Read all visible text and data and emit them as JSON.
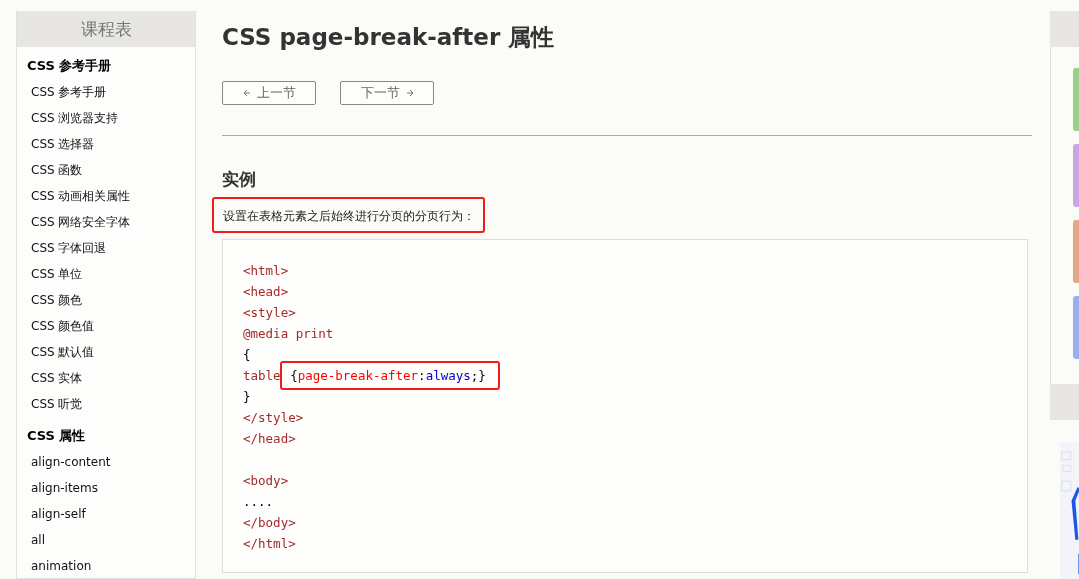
{
  "sidebar": {
    "title": "课程表",
    "sections": [
      {
        "heading": "CSS 参考手册",
        "items": [
          "CSS 参考手册",
          "CSS 浏览器支持",
          "CSS 选择器",
          "CSS 函数",
          "CSS 动画相关属性",
          "CSS 网络安全字体",
          "CSS 字体回退",
          "CSS 单位",
          "CSS 颜色",
          "CSS 颜色值",
          "CSS 默认值",
          "CSS 实体",
          "CSS 听觉"
        ]
      },
      {
        "heading": "CSS 属性",
        "items": [
          "align-content",
          "align-items",
          "align-self",
          "all",
          "animation"
        ]
      }
    ]
  },
  "main": {
    "title": "CSS page-break-after 属性",
    "nav_buttons": [
      {
        "kind": "prev",
        "label": "上一节"
      },
      {
        "kind": "next",
        "label": "下一节"
      }
    ],
    "example_heading": "实例",
    "description": {
      "text": "设置在表格元素之后始终进行分页的分页行为：",
      "boxed": true
    },
    "code_blocks": [
      {
        "lines": [
          {
            "segments": [
              {
                "kind": "tag",
                "text": "<html>"
              }
            ]
          },
          {
            "segments": [
              {
                "kind": "tag",
                "text": "<head>"
              }
            ]
          },
          {
            "segments": [
              {
                "kind": "tag",
                "text": "<style>"
              }
            ]
          },
          {
            "segments": [
              {
                "kind": "tag",
                "text": "@media print"
              }
            ]
          },
          {
            "segments": [
              {
                "kind": "punct",
                "text": "{"
              }
            ]
          },
          {
            "segments": [
              {
                "kind": "tag",
                "text": "table "
              }
            ],
            "boxed": [
              {
                "kind": "punct",
                "text": "{"
              },
              {
                "kind": "property",
                "text": "page-break-after"
              },
              {
                "kind": "punct",
                "text": ":"
              },
              {
                "kind": "value",
                "text": "always"
              },
              {
                "kind": "punct",
                "text": ";}"
              }
            ]
          },
          {
            "segments": [
              {
                "kind": "punct",
                "text": "}"
              }
            ]
          },
          {
            "segments": [
              {
                "kind": "tag",
                "text": "</style>"
              }
            ]
          },
          {
            "segments": [
              {
                "kind": "tag",
                "text": "</head>"
              }
            ]
          }
        ]
      },
      {
        "lines": [
          {
            "segments": [
              {
                "kind": "tag",
                "text": "<body>"
              }
            ]
          },
          {
            "segments": [
              {
                "kind": "punct",
                "text": "...."
              }
            ]
          },
          {
            "segments": [
              {
                "kind": "tag",
                "text": "</body>"
              }
            ]
          },
          {
            "segments": [
              {
                "kind": "tag",
                "text": "</html>"
              }
            ]
          }
        ]
      }
    ]
  },
  "right_panel": {
    "tiles": [
      {
        "color": "#98d088"
      },
      {
        "color": "#c8a8e0"
      },
      {
        "color": "#e4a888"
      },
      {
        "color": "#98b0f0"
      }
    ]
  }
}
